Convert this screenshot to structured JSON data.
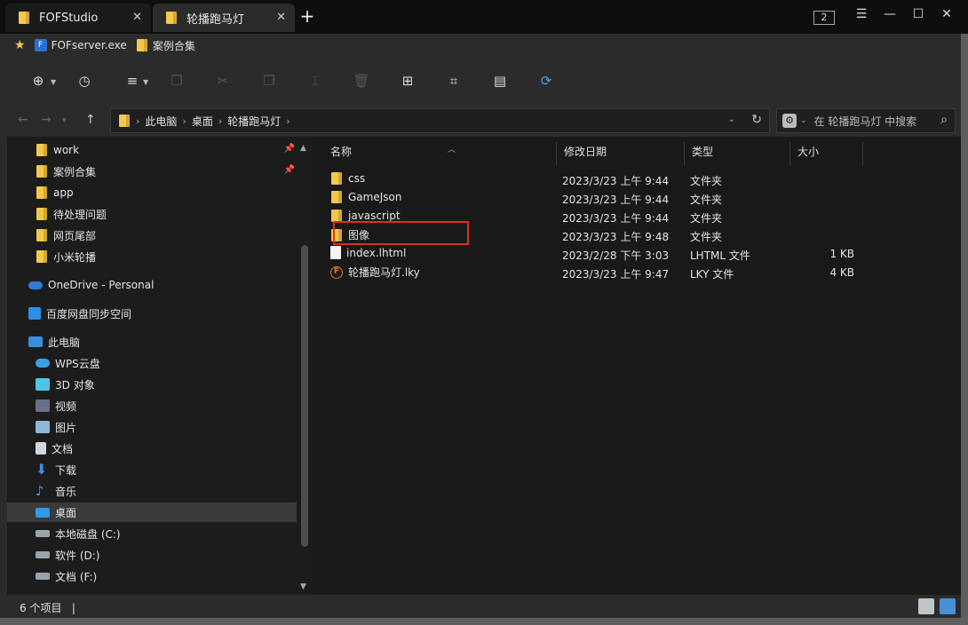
{
  "tabs": [
    {
      "label": "FOFStudio",
      "icon": "folder-icon",
      "close": "✕"
    },
    {
      "label": "轮播跑马灯",
      "icon": "folder-icon",
      "close": "✕"
    }
  ],
  "new_tab": "+",
  "window_count": "2",
  "window_controls": {
    "menu": "☰",
    "minimize": "—",
    "maximize": "☐",
    "close": "✕"
  },
  "bookmarks": [
    {
      "label": "FOFserver.exe",
      "icon": "exe-icon"
    },
    {
      "label": "案例合集",
      "icon": "folder-icon"
    }
  ],
  "address": {
    "crumbs": [
      "此电脑",
      "桌面",
      "轮播跑马灯"
    ],
    "search_placeholder": "在 轮播跑马灯 中搜索"
  },
  "sidebar": {
    "quick_access": [
      {
        "label": "work",
        "pinned": true
      },
      {
        "label": "案例合集",
        "pinned": true
      },
      {
        "label": "app",
        "pinned": false
      },
      {
        "label": "待处理问题",
        "pinned": false
      },
      {
        "label": "网页尾部",
        "pinned": false
      },
      {
        "label": "小米轮播",
        "pinned": false
      }
    ],
    "onedrive": "OneDrive - Personal",
    "baidu": "百度网盘同步空间",
    "this_pc": "此电脑",
    "pc_items": [
      {
        "label": "WPS云盘",
        "icon": "cloud-icon"
      },
      {
        "label": "3D 对象",
        "icon": "cube-icon"
      },
      {
        "label": "视频",
        "icon": "video-icon"
      },
      {
        "label": "图片",
        "icon": "picture-icon"
      },
      {
        "label": "文档",
        "icon": "document-icon"
      },
      {
        "label": "下载",
        "icon": "download-icon"
      },
      {
        "label": "音乐",
        "icon": "music-icon"
      },
      {
        "label": "桌面",
        "icon": "desktop-icon"
      },
      {
        "label": "本地磁盘 (C:)",
        "icon": "drive-icon"
      },
      {
        "label": "软件 (D:)",
        "icon": "drive-icon"
      },
      {
        "label": "文档 (F:)",
        "icon": "drive-icon"
      }
    ],
    "selected": "桌面"
  },
  "columns": [
    "名称",
    "修改日期",
    "类型",
    "大小"
  ],
  "files": [
    {
      "name": "css",
      "date": "2023/3/23 上午 9:44",
      "type": "文件夹",
      "size": "",
      "icon": "folder-icon"
    },
    {
      "name": "GameJson",
      "date": "2023/3/23 上午 9:44",
      "type": "文件夹",
      "size": "",
      "icon": "folder-icon"
    },
    {
      "name": "javascript",
      "date": "2023/3/23 上午 9:44",
      "type": "文件夹",
      "size": "",
      "icon": "folder-icon"
    },
    {
      "name": "图像",
      "date": "2023/3/23 上午 9:48",
      "type": "文件夹",
      "size": "",
      "icon": "folder-icon"
    },
    {
      "name": "index.lhtml",
      "date": "2023/2/28 下午 3:03",
      "type": "LHTML 文件",
      "size": "1 KB",
      "icon": "file-icon"
    },
    {
      "name": "轮播跑马灯.lky",
      "date": "2023/3/23 上午 9:47",
      "type": "LKY 文件",
      "size": "4 KB",
      "icon": "lky-icon"
    }
  ],
  "highlighted_file": "图像",
  "status": {
    "count": "6 个项目",
    "sep": "|"
  },
  "colors": {
    "folder": "#f4c84c",
    "highlight": "#e02a2a",
    "background": "#191919"
  }
}
